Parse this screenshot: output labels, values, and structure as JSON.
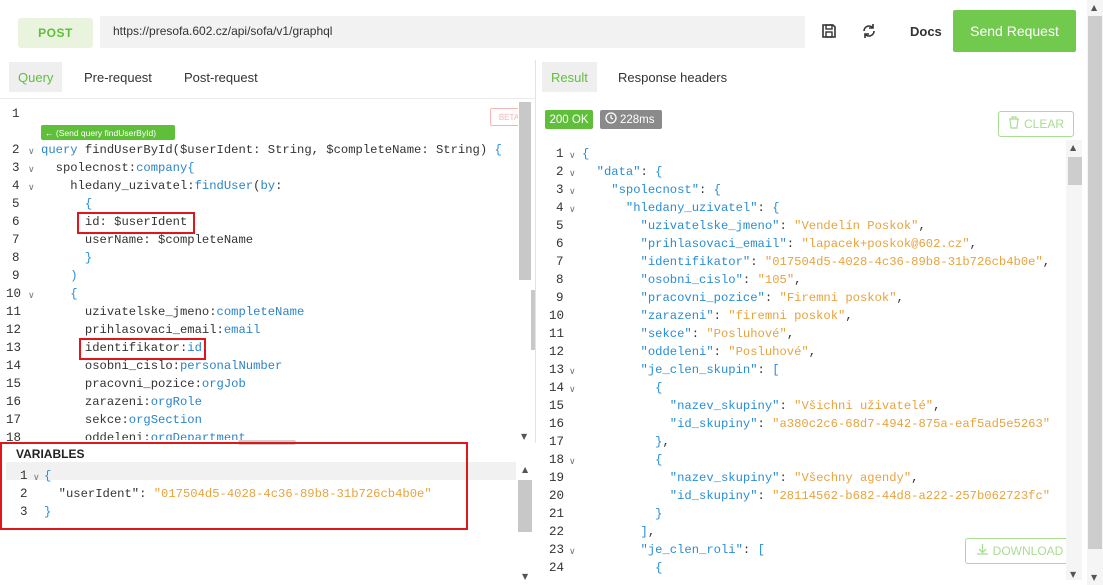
{
  "toolbar": {
    "method": "POST",
    "url": "https://presofa.602.cz/api/sofa/v1/graphql",
    "docs_label": "Docs",
    "send_label": "Send Request"
  },
  "left_tabs": [
    "Query",
    "Pre-request",
    "Post-request"
  ],
  "right_tabs": [
    "Result",
    "Response headers"
  ],
  "editor": {
    "beta_label": "BETA",
    "codelens": "← (Send query findUserById)",
    "line_numbers": [
      "1",
      "2",
      "3",
      "4",
      "5",
      "6",
      "7",
      "8",
      "9",
      "10",
      "11",
      "12",
      "13",
      "14",
      "15",
      "16",
      "17",
      "18"
    ]
  },
  "variables": {
    "header": "VARIABLES",
    "line_numbers": [
      "1",
      "2",
      "3"
    ]
  },
  "result": {
    "status": "200 OK",
    "time": "228ms",
    "clear_label": "CLEAR",
    "download_label": "DOWNLOAD",
    "line_numbers": [
      "1",
      "2",
      "3",
      "4",
      "5",
      "6",
      "7",
      "8",
      "9",
      "10",
      "11",
      "12",
      "13",
      "14",
      "15",
      "16",
      "17",
      "18",
      "19",
      "20",
      "21",
      "22",
      "23",
      "24"
    ]
  },
  "colors": {
    "accent": "#71c94e",
    "highlight": "#e0161b"
  }
}
